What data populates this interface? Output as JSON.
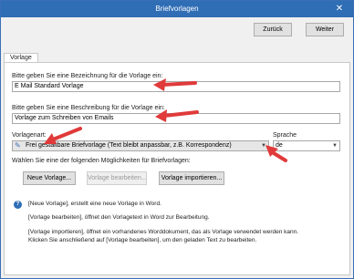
{
  "window": {
    "title": "Briefvorlagen"
  },
  "toolbar": {
    "back_label": "Zurück",
    "next_label": "Weiter"
  },
  "tabs": [
    {
      "label": "Vorlage"
    }
  ],
  "form": {
    "name_label": "Bitte geben Sie eine Bezeichnung für die Vorlage ein:",
    "name_value": "E Mail Standard Vorlage",
    "desc_label": "Bitte geben Sie eine Beschreibung für die Vorlage ein:",
    "desc_value": "Vorlage zum Schreiben von Emails",
    "type_label": "Vorlagenart:",
    "type_value": "Frei gestaltbare Briefvorlage (Text bleibt anpassbar, z.B. Korrespondenz)",
    "lang_label": "Sprache",
    "lang_value": "de",
    "options_label": "Wählen Sie eine der folgenden Möglichkeiten für Briefvorlagen:"
  },
  "actions": {
    "new_label": "Neue Vorlage...",
    "edit_label": "Vorlage bearbeiten...",
    "import_label": "Vorlage importieren..."
  },
  "help": {
    "line1": "[Neue Vorlage], erstellt eine neue Vorlage in Word.",
    "line2": "[Vorlage bearbeiten], öffnet den Vorlagetext in Word zur Bearbeitung.",
    "line3": "[Vorlage importieren], öffnet ein vorhandenes Worddokument, das als Vorlage verwendet werden kann.",
    "line4": "Klicken Sie anschließend auf [Vorlage bearbeiten], um den geladen Text zu bearbeiten."
  },
  "colors": {
    "titlebar": "#2f6db5",
    "annotation": "#e03a3a"
  },
  "icons": {
    "close": "close-icon",
    "dropdown": "chevron-down-icon",
    "help": "help-icon",
    "pencil": "pencil-icon"
  }
}
